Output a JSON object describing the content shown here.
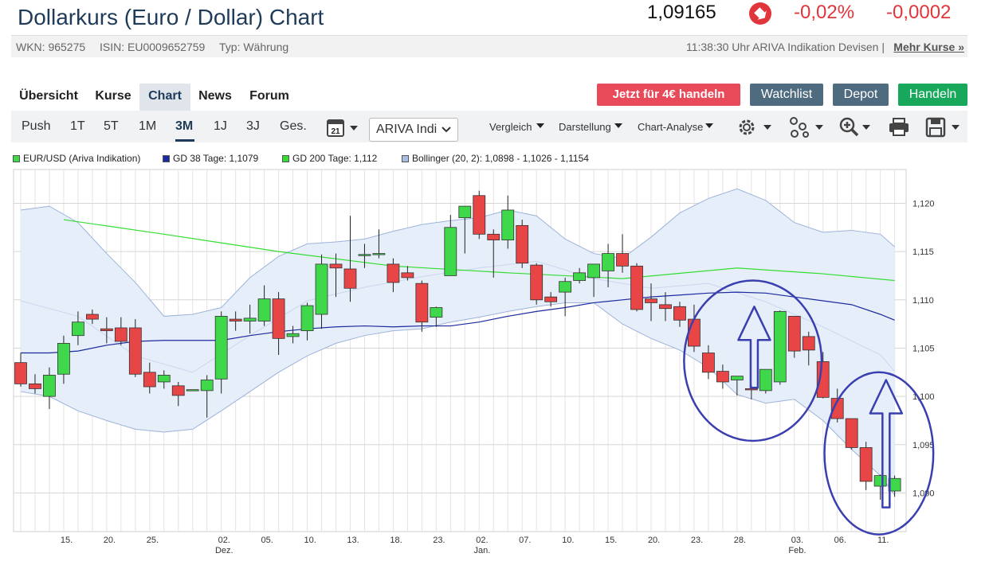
{
  "header": {
    "title": "Dollarkurs (Euro / Dollar) Chart",
    "price": "1,09165",
    "change_pct": "-0,02%",
    "change_abs": "-0,0002",
    "trend_icon": "down-arrow-icon"
  },
  "meta": {
    "wkn": "WKN: 965275",
    "isin": "ISIN: EU0009652759",
    "typ": "Typ: Währung",
    "indication": "11:38:30 Uhr ARIVA Indikation Devisen |",
    "more_link": "Mehr Kurse »"
  },
  "nav": {
    "tabs": [
      "Übersicht",
      "Kurse",
      "Chart",
      "News",
      "Forum"
    ],
    "active": "Chart",
    "buttons": {
      "trade_cta": "Jetzt für 4€ handeln",
      "watchlist": "Watchlist",
      "depot": "Depot",
      "handeln": "Handeln"
    }
  },
  "toolbar": {
    "ranges": [
      "Push",
      "1T",
      "5T",
      "1M",
      "3M",
      "1J",
      "3J",
      "Ges."
    ],
    "active_range": "3M",
    "calendar_day": "21",
    "source_select": "ARIVA Indi",
    "menus": [
      "Vergleich",
      "Darstellung",
      "Chart-Analyse"
    ]
  },
  "colors": {
    "up": "#3fd84a",
    "down": "#e84646",
    "band_fill": "#e6eefa",
    "band_line": "#9db3d8",
    "ma38": "#1c2aa0",
    "ma200": "#33dd33",
    "annotation": "#3a3fb0",
    "accent": "#1f3b5a",
    "cta": "#e94a5a",
    "slate": "#4f6b80",
    "green_btn": "#17a85b"
  },
  "chart_data": {
    "type": "candlestick",
    "legend": [
      {
        "label": "EUR/USD (Ariva Indikation)",
        "color": "#3fd84a"
      },
      {
        "label": "GD 38 Tage: 1,1079",
        "color": "#1c2aa0"
      },
      {
        "label": "GD 200 Tage: 1,112",
        "color": "#33dd33"
      },
      {
        "label": "Bollinger (20, 2): 1,0898 - 1,1026 - 1,1154",
        "color": "#a9bde0"
      }
    ],
    "ylim": [
      1.086,
      1.1235
    ],
    "yticks": [
      "1,090",
      "1,095",
      "1,100",
      "1,105",
      "1,110",
      "1,115",
      "1,120"
    ],
    "ytick_values": [
      1.09,
      1.095,
      1.1,
      1.105,
      1.11,
      1.115,
      1.12
    ],
    "xlim": [
      0,
      62.3
    ],
    "xticks": [
      {
        "label": "15.",
        "sub": "",
        "x": 3.7
      },
      {
        "label": "20.",
        "sub": "",
        "x": 6.7
      },
      {
        "label": "25.",
        "sub": "",
        "x": 9.7
      },
      {
        "label": "02.",
        "sub": "Dez.",
        "x": 14.7
      },
      {
        "label": "05.",
        "sub": "",
        "x": 17.7
      },
      {
        "label": "10.",
        "sub": "",
        "x": 20.7
      },
      {
        "label": "13.",
        "sub": "",
        "x": 23.7
      },
      {
        "label": "18.",
        "sub": "",
        "x": 26.7
      },
      {
        "label": "23.",
        "sub": "",
        "x": 29.7
      },
      {
        "label": "02.",
        "sub": "Jan.",
        "x": 32.7
      },
      {
        "label": "07.",
        "sub": "",
        "x": 35.7
      },
      {
        "label": "10.",
        "sub": "",
        "x": 38.7
      },
      {
        "label": "15.",
        "sub": "",
        "x": 41.7
      },
      {
        "label": "20.",
        "sub": "",
        "x": 44.7
      },
      {
        "label": "23.",
        "sub": "",
        "x": 47.7
      },
      {
        "label": "28.",
        "sub": "",
        "x": 50.7
      },
      {
        "label": "03.",
        "sub": "Feb.",
        "x": 54.7
      },
      {
        "label": "06.",
        "sub": "",
        "x": 57.7
      },
      {
        "label": "11.",
        "sub": "",
        "x": 60.7
      }
    ],
    "candles": [
      {
        "x": 0.5,
        "o": 1.1035,
        "h": 1.1045,
        "l": 1.101,
        "c": 1.1013
      },
      {
        "x": 1.5,
        "o": 1.1013,
        "h": 1.1023,
        "l": 1.1003,
        "c": 1.1008
      },
      {
        "x": 2.5,
        "o": 1.1,
        "h": 1.103,
        "l": 1.0987,
        "c": 1.1022
      },
      {
        "x": 3.5,
        "o": 1.1023,
        "h": 1.1063,
        "l": 1.1013,
        "c": 1.1055
      },
      {
        "x": 4.5,
        "o": 1.1063,
        "h": 1.1088,
        "l": 1.1053,
        "c": 1.1077
      },
      {
        "x": 5.5,
        "o": 1.1085,
        "h": 1.109,
        "l": 1.1075,
        "c": 1.108
      },
      {
        "x": 6.5,
        "o": 1.107,
        "h": 1.1082,
        "l": 1.1055,
        "c": 1.1068
      },
      {
        "x": 7.5,
        "o": 1.1071,
        "h": 1.1082,
        "l": 1.1053,
        "c": 1.1057
      },
      {
        "x": 8.5,
        "o": 1.1071,
        "h": 1.108,
        "l": 1.102,
        "c": 1.1023
      },
      {
        "x": 9.5,
        "o": 1.1025,
        "h": 1.1035,
        "l": 1.1003,
        "c": 1.101
      },
      {
        "x": 10.5,
        "o": 1.1015,
        "h": 1.1027,
        "l": 1.1008,
        "c": 1.1022
      },
      {
        "x": 11.5,
        "o": 1.1011,
        "h": 1.1015,
        "l": 1.099,
        "c": 1.1001
      },
      {
        "x": 12.5,
        "o": 1.1007,
        "h": 1.1007,
        "l": 1.1007,
        "c": 1.1007
      },
      {
        "x": 13.5,
        "o": 1.1006,
        "h": 1.1022,
        "l": 1.0978,
        "c": 1.1017
      },
      {
        "x": 14.5,
        "o": 1.1018,
        "h": 1.1088,
        "l": 1.1003,
        "c": 1.1083
      },
      {
        "x": 15.5,
        "o": 1.108,
        "h": 1.1088,
        "l": 1.1068,
        "c": 1.1078
      },
      {
        "x": 16.5,
        "o": 1.1078,
        "h": 1.1095,
        "l": 1.1065,
        "c": 1.1081
      },
      {
        "x": 17.5,
        "o": 1.1078,
        "h": 1.1115,
        "l": 1.1073,
        "c": 1.1101
      },
      {
        "x": 18.5,
        "o": 1.1101,
        "h": 1.1108,
        "l": 1.1043,
        "c": 1.106
      },
      {
        "x": 19.5,
        "o": 1.1062,
        "h": 1.1073,
        "l": 1.1055,
        "c": 1.1065
      },
      {
        "x": 20.5,
        "o": 1.1068,
        "h": 1.1097,
        "l": 1.1058,
        "c": 1.1094
      },
      {
        "x": 21.5,
        "o": 1.1085,
        "h": 1.1147,
        "l": 1.107,
        "c": 1.1137
      },
      {
        "x": 22.5,
        "o": 1.1137,
        "h": 1.1148,
        "l": 1.1103,
        "c": 1.1133
      },
      {
        "x": 23.5,
        "o": 1.1132,
        "h": 1.1187,
        "l": 1.1098,
        "c": 1.1112
      },
      {
        "x": 24.5,
        "o": 1.1147,
        "h": 1.1158,
        "l": 1.1133,
        "c": 1.1147
      },
      {
        "x": 25.5,
        "o": 1.1148,
        "h": 1.1173,
        "l": 1.1143,
        "c": 1.1148
      },
      {
        "x": 26.5,
        "o": 1.1137,
        "h": 1.1143,
        "l": 1.1108,
        "c": 1.1118
      },
      {
        "x": 27.5,
        "o": 1.1128,
        "h": 1.1135,
        "l": 1.112,
        "c": 1.1123
      },
      {
        "x": 28.5,
        "o": 1.1117,
        "h": 1.112,
        "l": 1.1067,
        "c": 1.1077
      },
      {
        "x": 29.5,
        "o": 1.1082,
        "h": 1.1093,
        "l": 1.1072,
        "c": 1.1092
      },
      {
        "x": 30.5,
        "o": 1.1125,
        "h": 1.1188,
        "l": 1.1125,
        "c": 1.1175
      },
      {
        "x": 31.5,
        "o": 1.1185,
        "h": 1.1197,
        "l": 1.1148,
        "c": 1.1197
      },
      {
        "x": 32.5,
        "o": 1.1208,
        "h": 1.1213,
        "l": 1.1163,
        "c": 1.1168
      },
      {
        "x": 33.5,
        "o": 1.1168,
        "h": 1.1173,
        "l": 1.1123,
        "c": 1.1162
      },
      {
        "x": 34.5,
        "o": 1.1162,
        "h": 1.1208,
        "l": 1.1153,
        "c": 1.1193
      },
      {
        "x": 35.5,
        "o": 1.1177,
        "h": 1.1183,
        "l": 1.1133,
        "c": 1.1138
      },
      {
        "x": 36.5,
        "o": 1.1136,
        "h": 1.1138,
        "l": 1.1095,
        "c": 1.11
      },
      {
        "x": 37.5,
        "o": 1.1103,
        "h": 1.1108,
        "l": 1.1093,
        "c": 1.1098
      },
      {
        "x": 38.5,
        "o": 1.1108,
        "h": 1.1123,
        "l": 1.1083,
        "c": 1.1119
      },
      {
        "x": 39.5,
        "o": 1.112,
        "h": 1.1133,
        "l": 1.1117,
        "c": 1.1128
      },
      {
        "x": 40.5,
        "o": 1.1123,
        "h": 1.1137,
        "l": 1.1103,
        "c": 1.1137
      },
      {
        "x": 41.5,
        "o": 1.113,
        "h": 1.1158,
        "l": 1.1113,
        "c": 1.1148
      },
      {
        "x": 42.5,
        "o": 1.1148,
        "h": 1.1168,
        "l": 1.1128,
        "c": 1.1135
      },
      {
        "x": 43.5,
        "o": 1.1135,
        "h": 1.1138,
        "l": 1.1088,
        "c": 1.109
      },
      {
        "x": 44.5,
        "o": 1.1101,
        "h": 1.1117,
        "l": 1.1078,
        "c": 1.1097
      },
      {
        "x": 45.5,
        "o": 1.1095,
        "h": 1.1108,
        "l": 1.1078,
        "c": 1.1091
      },
      {
        "x": 46.5,
        "o": 1.1093,
        "h": 1.1098,
        "l": 1.1072,
        "c": 1.1079
      },
      {
        "x": 47.5,
        "o": 1.108,
        "h": 1.1095,
        "l": 1.1046,
        "c": 1.1052
      },
      {
        "x": 48.5,
        "o": 1.1045,
        "h": 1.1053,
        "l": 1.1018,
        "c": 1.1025
      },
      {
        "x": 49.5,
        "o": 1.1026,
        "h": 1.1033,
        "l": 1.1008,
        "c": 1.1015
      },
      {
        "x": 50.5,
        "o": 1.1017,
        "h": 1.102,
        "l": 1.1001,
        "c": 1.1021
      },
      {
        "x": 51.5,
        "o": 1.1008,
        "h": 1.1012,
        "l": 1.0997,
        "c": 1.1007
      },
      {
        "x": 52.5,
        "o": 1.1006,
        "h": 1.1028,
        "l": 1.1003,
        "c": 1.1028
      },
      {
        "x": 53.5,
        "o": 1.1015,
        "h": 1.1089,
        "l": 1.1012,
        "c": 1.1088
      },
      {
        "x": 54.5,
        "o": 1.1083,
        "h": 1.1083,
        "l": 1.104,
        "c": 1.1047
      },
      {
        "x": 55.5,
        "o": 1.1062,
        "h": 1.1067,
        "l": 1.1032,
        "c": 1.1048
      },
      {
        "x": 56.5,
        "o": 1.1036,
        "h": 1.1046,
        "l": 1.0998,
        "c": 1.0999
      },
      {
        "x": 57.5,
        "o": 1.0998,
        "h": 1.1008,
        "l": 1.0973,
        "c": 1.0977
      },
      {
        "x": 58.5,
        "o": 1.0977,
        "h": 1.0977,
        "l": 1.0945,
        "c": 1.0947
      },
      {
        "x": 59.5,
        "o": 1.0947,
        "h": 1.0953,
        "l": 1.0903,
        "c": 1.0912
      },
      {
        "x": 60.5,
        "o": 1.0907,
        "h": 1.0919,
        "l": 1.0893,
        "c": 1.0918
      },
      {
        "x": 61.5,
        "o": 1.0902,
        "h": 1.0918,
        "l": 1.0896,
        "c": 1.0915
      }
    ],
    "bollinger_upper": [
      [
        0.5,
        1.1193
      ],
      [
        2.5,
        1.1197
      ],
      [
        4.5,
        1.118
      ],
      [
        6.5,
        1.1148
      ],
      [
        8.5,
        1.1118
      ],
      [
        10.5,
        1.1083
      ],
      [
        12.5,
        1.1085
      ],
      [
        14.5,
        1.1092
      ],
      [
        16.5,
        1.1123
      ],
      [
        18.5,
        1.1145
      ],
      [
        20.5,
        1.1158
      ],
      [
        22.5,
        1.116
      ],
      [
        24.5,
        1.1163
      ],
      [
        26.5,
        1.1171
      ],
      [
        28.5,
        1.1178
      ],
      [
        30.5,
        1.1182
      ],
      [
        32.5,
        1.1185
      ],
      [
        34.5,
        1.1193
      ],
      [
        36.5,
        1.1187
      ],
      [
        38.5,
        1.1163
      ],
      [
        40.5,
        1.1148
      ],
      [
        42.5,
        1.1143
      ],
      [
        44.5,
        1.1165
      ],
      [
        46.5,
        1.119
      ],
      [
        48.5,
        1.1205
      ],
      [
        50.5,
        1.1215
      ],
      [
        52.5,
        1.1203
      ],
      [
        54.5,
        1.118
      ],
      [
        56.5,
        1.117
      ],
      [
        58.5,
        1.1172
      ],
      [
        60.5,
        1.1168
      ],
      [
        61.5,
        1.1155
      ]
    ],
    "bollinger_lower": [
      [
        0.5,
        1.1005
      ],
      [
        2.5,
        1.1
      ],
      [
        4.5,
        1.0985
      ],
      [
        6.5,
        1.0975
      ],
      [
        8.5,
        1.0966
      ],
      [
        10.5,
        1.0963
      ],
      [
        12.5,
        1.0966
      ],
      [
        14.5,
        1.0985
      ],
      [
        16.5,
        1.1005
      ],
      [
        18.5,
        1.1025
      ],
      [
        20.5,
        1.1042
      ],
      [
        22.5,
        1.1055
      ],
      [
        24.5,
        1.1063
      ],
      [
        26.5,
        1.1068
      ],
      [
        28.5,
        1.107
      ],
      [
        30.5,
        1.1077
      ],
      [
        32.5,
        1.1082
      ],
      [
        34.5,
        1.1088
      ],
      [
        36.5,
        1.1093
      ],
      [
        38.5,
        1.1097
      ],
      [
        40.5,
        1.1097
      ],
      [
        42.5,
        1.1075
      ],
      [
        44.5,
        1.106
      ],
      [
        46.5,
        1.1048
      ],
      [
        48.5,
        1.103
      ],
      [
        50.5,
        1.1002
      ],
      [
        52.5,
        1.0993
      ],
      [
        54.5,
        1.0997
      ],
      [
        56.5,
        1.0975
      ],
      [
        58.5,
        1.0945
      ],
      [
        60.5,
        1.0918
      ],
      [
        61.5,
        1.0898
      ]
    ],
    "bollinger_mid": [
      [
        0.5,
        1.1099
      ],
      [
        4.5,
        1.1083
      ],
      [
        8.5,
        1.1042
      ],
      [
        12.5,
        1.1025
      ],
      [
        16.5,
        1.1063
      ],
      [
        20.5,
        1.1099
      ],
      [
        24.5,
        1.1113
      ],
      [
        28.5,
        1.1124
      ],
      [
        32.5,
        1.1133
      ],
      [
        36.5,
        1.114
      ],
      [
        40.5,
        1.1122
      ],
      [
        44.5,
        1.1112
      ],
      [
        48.5,
        1.1117
      ],
      [
        52.5,
        1.1098
      ],
      [
        56.5,
        1.1072
      ],
      [
        60.5,
        1.1043
      ],
      [
        61.5,
        1.1026
      ]
    ],
    "ma38": [
      [
        0.5,
        1.1045
      ],
      [
        2.5,
        1.1045
      ],
      [
        4.5,
        1.1047
      ],
      [
        6.5,
        1.1053
      ],
      [
        8.5,
        1.1057
      ],
      [
        10.5,
        1.1058
      ],
      [
        12.5,
        1.1058
      ],
      [
        14.5,
        1.1058
      ],
      [
        16.5,
        1.1063
      ],
      [
        18.5,
        1.1067
      ],
      [
        20.5,
        1.107
      ],
      [
        22.5,
        1.1072
      ],
      [
        24.5,
        1.1073
      ],
      [
        26.5,
        1.1072
      ],
      [
        28.5,
        1.1073
      ],
      [
        30.5,
        1.1073
      ],
      [
        32.5,
        1.1077
      ],
      [
        34.5,
        1.1083
      ],
      [
        36.5,
        1.1088
      ],
      [
        38.5,
        1.1092
      ],
      [
        40.5,
        1.1097
      ],
      [
        42.5,
        1.11
      ],
      [
        44.5,
        1.1103
      ],
      [
        46.5,
        1.1105
      ],
      [
        48.5,
        1.1107
      ],
      [
        50.5,
        1.1108
      ],
      [
        52.5,
        1.1107
      ],
      [
        54.5,
        1.1103
      ],
      [
        56.5,
        1.1099
      ],
      [
        58.5,
        1.1095
      ],
      [
        60.5,
        1.1085
      ],
      [
        61.5,
        1.1079
      ]
    ],
    "ma200": [
      [
        3.5,
        1.1183
      ],
      [
        10.5,
        1.1168
      ],
      [
        18.5,
        1.115
      ],
      [
        26.5,
        1.1135
      ],
      [
        34.5,
        1.1128
      ],
      [
        42.5,
        1.1122
      ],
      [
        50.5,
        1.1133
      ],
      [
        56.5,
        1.1127
      ],
      [
        61.5,
        1.112
      ]
    ],
    "annotations": [
      {
        "type": "ellipse",
        "cx": 51.6,
        "cy": 1.1037,
        "rx": 4.8,
        "ry": 0.0083
      },
      {
        "type": "arrow-up",
        "x": 51.7,
        "y_bottom": 1.1009,
        "y_top": 1.1093
      },
      {
        "type": "ellipse",
        "cx": 60.4,
        "cy": 1.0941,
        "rx": 3.8,
        "ry": 0.0084
      },
      {
        "type": "arrow-up",
        "x": 60.9,
        "y_bottom": 1.0885,
        "y_top": 1.1017
      }
    ]
  }
}
